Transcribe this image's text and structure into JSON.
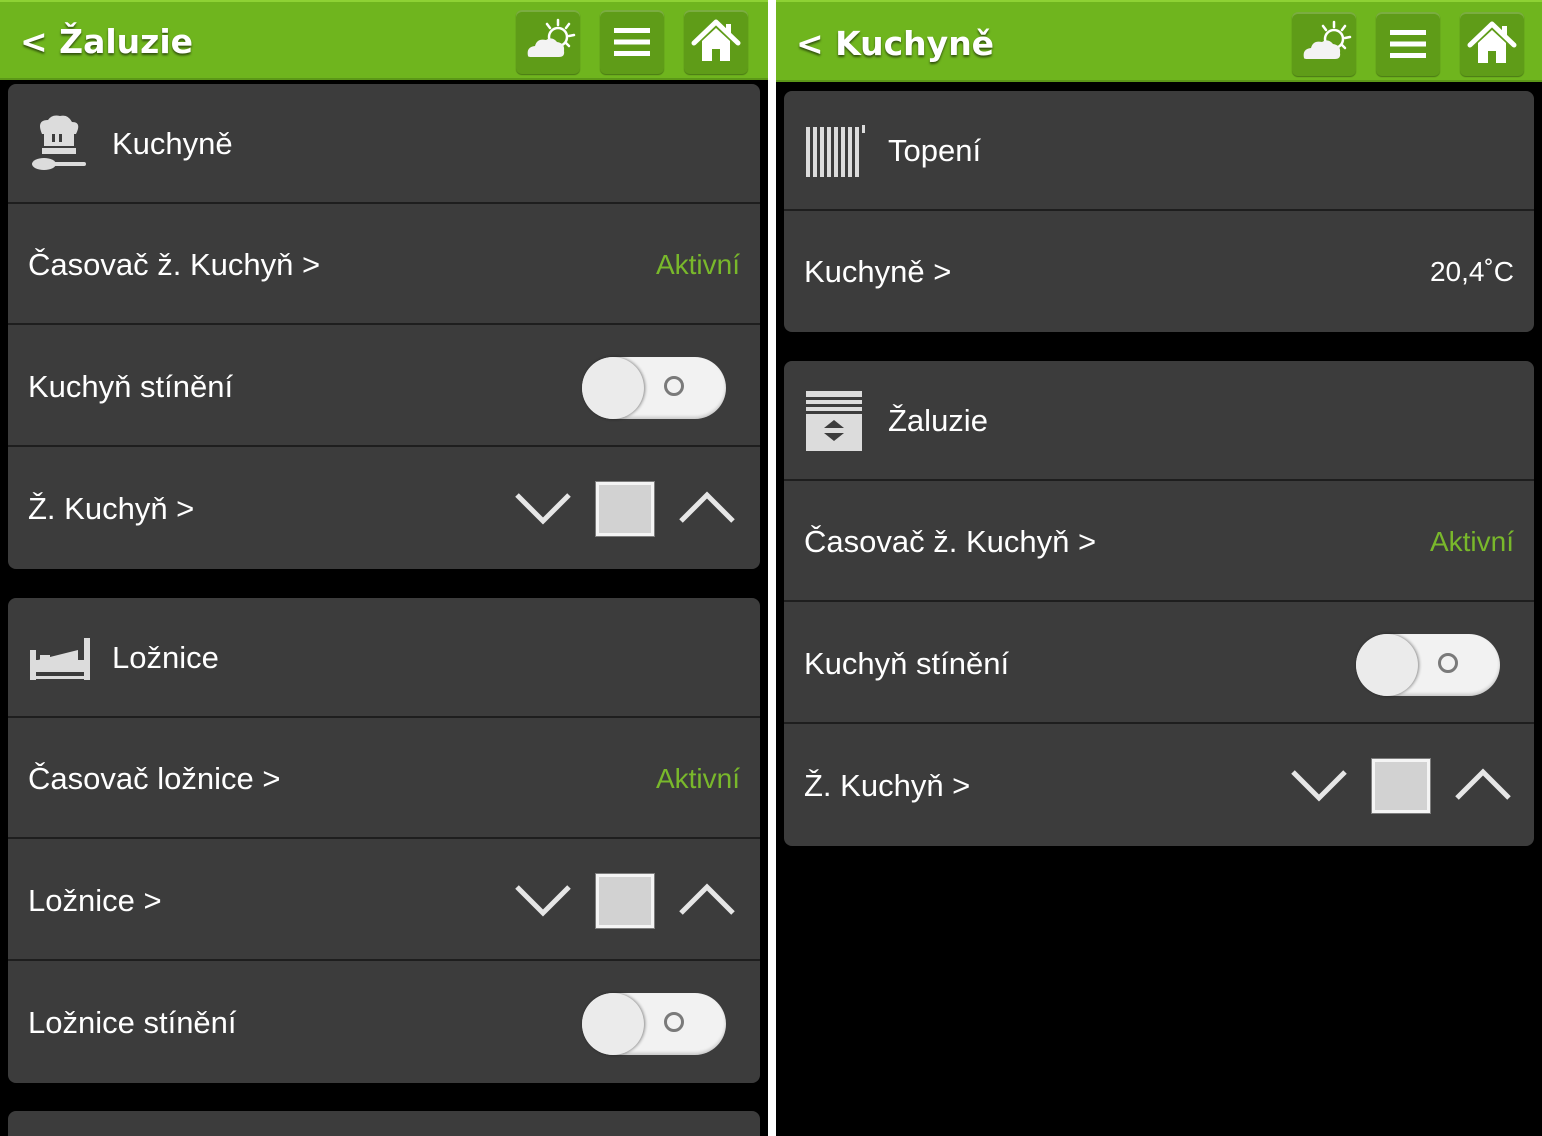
{
  "colors": {
    "brand_green": "#6fb51e",
    "active_text": "#79b82b",
    "card_bg": "#3c3c3c"
  },
  "left": {
    "header": {
      "title": "< Žaluzie",
      "icons": [
        "weather-icon",
        "menu-icon",
        "home-icon"
      ]
    },
    "sections": [
      {
        "room": "Kuchyně",
        "icon": "chef-hat-icon",
        "rows": [
          {
            "label": "Časovač ž. Kuchyň >",
            "value": "Aktivní"
          },
          {
            "label": "Kuchyň stínění",
            "control": "toggle",
            "state": "off"
          },
          {
            "label": "Ž. Kuchyň >",
            "control": "blind-controls"
          }
        ]
      },
      {
        "room": "Ložnice",
        "icon": "bed-icon",
        "rows": [
          {
            "label": "Časovač ložnice >",
            "value": "Aktivní"
          },
          {
            "label": "Ložnice >",
            "control": "blind-controls"
          },
          {
            "label": "Ložnice stínění",
            "control": "toggle",
            "state": "off"
          }
        ]
      }
    ]
  },
  "right": {
    "header": {
      "title": "< Kuchyně",
      "icons": [
        "weather-icon",
        "menu-icon",
        "home-icon"
      ]
    },
    "sections": [
      {
        "category": "Topení",
        "icon": "radiator-icon",
        "rows": [
          {
            "label": "Kuchyně >",
            "value": "20,4˚C"
          }
        ]
      },
      {
        "category": "Žaluzie",
        "icon": "blinds-icon",
        "rows": [
          {
            "label": "Časovač ž. Kuchyň >",
            "value": "Aktivní"
          },
          {
            "label": "Kuchyň stínění",
            "control": "toggle",
            "state": "off"
          },
          {
            "label": "Ž. Kuchyň >",
            "control": "blind-controls"
          }
        ]
      }
    ]
  }
}
